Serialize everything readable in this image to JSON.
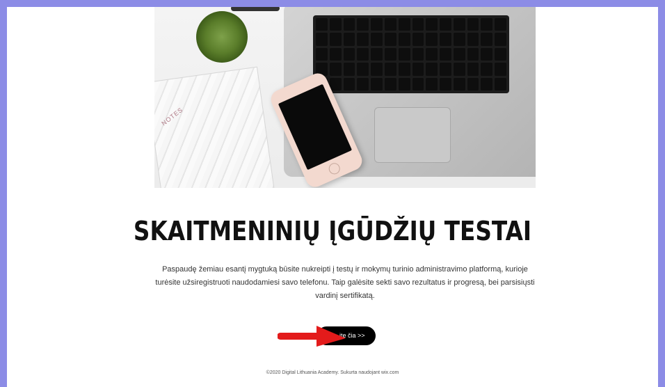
{
  "hero": {
    "notebook_label": "NOTES"
  },
  "main": {
    "title": "SKAITMENINIŲ ĮGŪDŽIŲ TESTAI",
    "description": "Paspaudę žemiau esantį mygtuką būsite nukreipti į testų ir mokymų turinio administravimo platformą, kurioje turėsite užsiregistruoti naudodamiesi savo telefonu. Taip galėsite sekti savo rezultatus ir progresą, bei parsisiųsti vardinį sertifikatą.",
    "cta_label": "ite čia >>"
  },
  "footer": {
    "text": "©2020 Digital Lithuania Academy. Sukurta naudojant wix.com"
  },
  "colors": {
    "background": "#8c8ce6",
    "page": "#ffffff",
    "button": "#000000",
    "arrow": "#e31b1b"
  },
  "icons": {
    "annotation": "red-arrow-icon"
  }
}
